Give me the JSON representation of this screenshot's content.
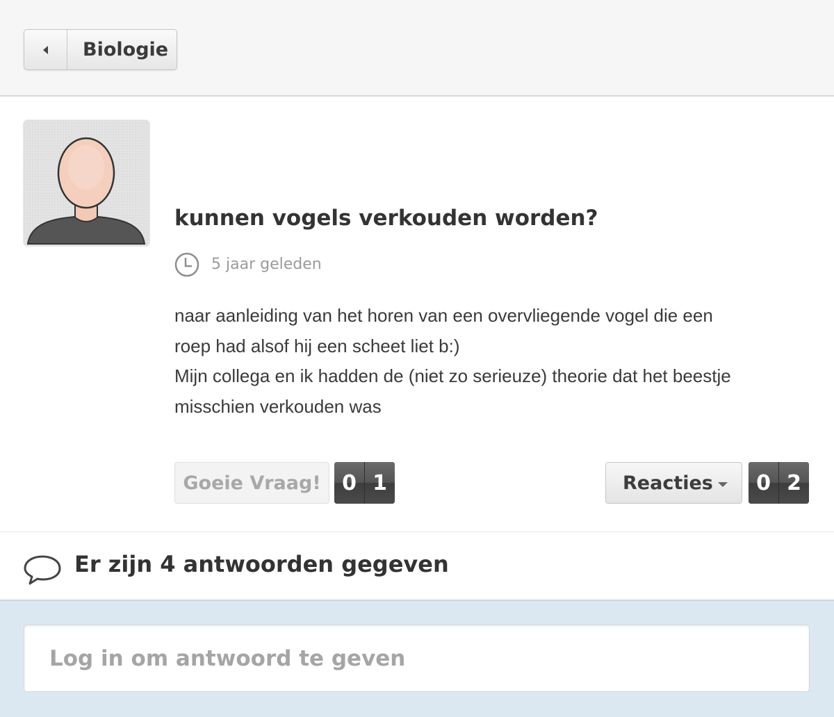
{
  "header": {
    "back_label": "Biologie",
    "back_icon": "caret-left-icon"
  },
  "question": {
    "title": "kunnen vogels verkouden worden?",
    "time": "5 jaar geleden",
    "body": [
      "naar aanleiding van het horen van een overvliegende vogel die een",
      "roep had alsof hij een scheet liet b:)",
      "Mijn collega en ik hadden de (niet zo serieuze) theorie dat het beestje",
      "misschien verkouden was"
    ]
  },
  "actions": {
    "good_question_label": "Goeie Vraag!",
    "good_question_count_digits": [
      "0",
      "1"
    ],
    "reactions_label": "Reacties",
    "reactions_count_digits": [
      "0",
      "2"
    ]
  },
  "answers": {
    "title": "Er zijn 4 antwoorden gegeven"
  },
  "login": {
    "prompt": "Log in om antwoord te geven"
  },
  "colors": {
    "header_bg": "#f6f6f6",
    "bottom_bg": "#dce8f1",
    "counter_bg": "#4b4b4b",
    "muted_text": "#a5a5a5"
  }
}
